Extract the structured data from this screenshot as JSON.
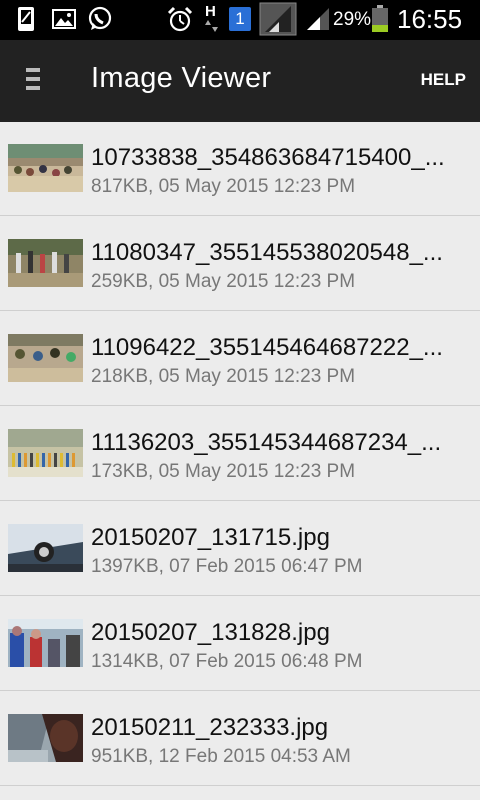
{
  "status_bar": {
    "battery_percent": "29%",
    "time": "16:55",
    "sim_badge": "1",
    "network_type": "H",
    "icons": [
      "sim-card-icon",
      "gallery-icon",
      "whatsapp-icon",
      "alarm-icon",
      "network-data-icon",
      "sim-slot-icon",
      "signal-icon",
      "signal-icon",
      "battery-icon"
    ],
    "colors": {
      "battery_fill": "#9ccc23",
      "sim_badge": "#2a6fd6"
    }
  },
  "app_bar": {
    "title": "Image Viewer",
    "help_label": "HELP",
    "menu_icon": "menu-icon",
    "colors": {
      "background": "#222222"
    }
  },
  "files": [
    {
      "name": "10733838_354863684715400_...",
      "meta": "817KB, 05 May 2015 12:23 PM"
    },
    {
      "name": "11080347_355145538020548_...",
      "meta": "259KB, 05 May 2015 12:23 PM"
    },
    {
      "name": "11096422_355145464687222_...",
      "meta": "218KB, 05 May 2015 12:23 PM"
    },
    {
      "name": "11136203_355145344687234_...",
      "meta": "173KB, 05 May 2015 12:23 PM"
    },
    {
      "name": "20150207_131715.jpg",
      "meta": "1397KB, 07 Feb 2015 06:47 PM"
    },
    {
      "name": "20150207_131828.jpg",
      "meta": "1314KB, 07 Feb 2015 06:48 PM"
    },
    {
      "name": "20150211_232333.jpg",
      "meta": "951KB, 12 Feb 2015 04:53 AM"
    }
  ]
}
